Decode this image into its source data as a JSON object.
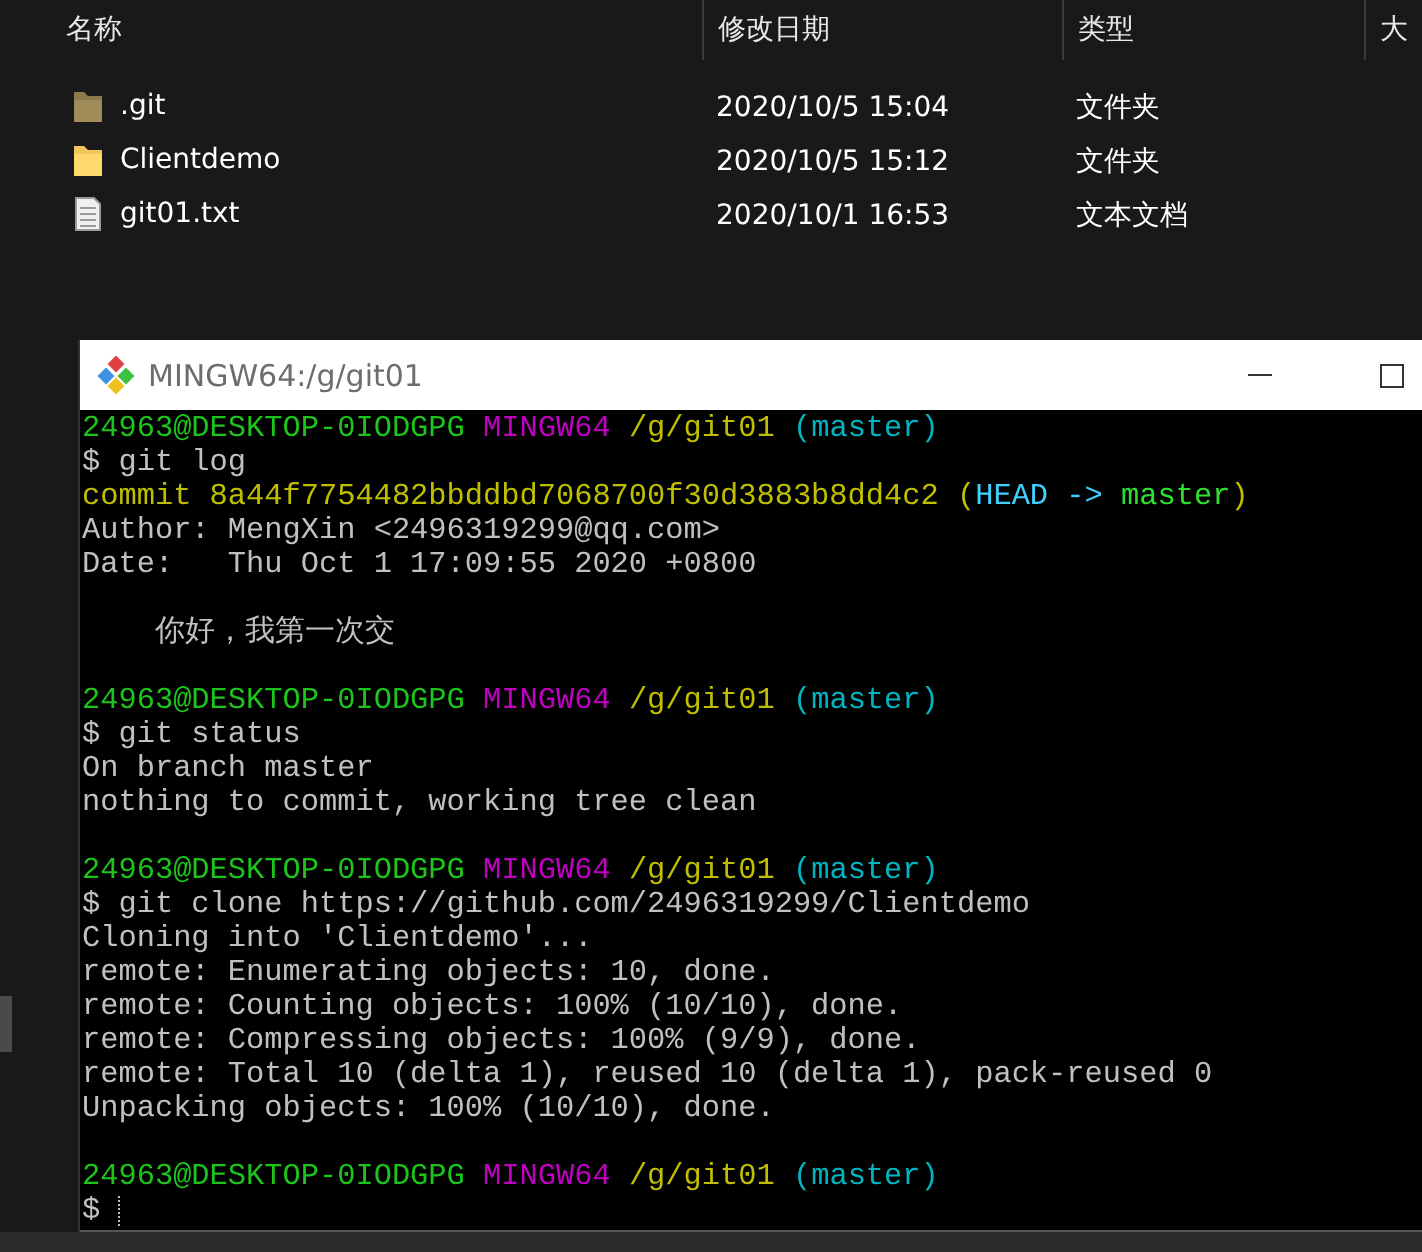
{
  "explorer": {
    "columns": [
      "名称",
      "修改日期",
      "类型",
      "大"
    ],
    "rows": [
      {
        "kind": "folder",
        "hidden": true,
        "name": ".git",
        "modified": "2020/10/5 15:04",
        "type": "文件夹"
      },
      {
        "kind": "folder",
        "hidden": false,
        "name": "Clientdemo",
        "modified": "2020/10/5 15:12",
        "type": "文件夹"
      },
      {
        "kind": "file",
        "hidden": false,
        "name": "git01.txt",
        "modified": "2020/10/1 16:53",
        "type": "文本文档"
      }
    ]
  },
  "terminal": {
    "title": "MINGW64:/g/git01",
    "blocks": [
      [
        {
          "spans": [
            {
              "kind": "user",
              "text": "24963@DESKTOP-0IODGPG"
            },
            {
              "kind": "host",
              "text": " MINGW64"
            },
            {
              "kind": "path",
              "text": " /g/git01"
            },
            {
              "kind": "branch",
              "text": " (master)"
            }
          ]
        },
        {
          "spans": [
            {
              "kind": "text",
              "text": "$ git log"
            }
          ]
        },
        {
          "spans": [
            {
              "kind": "commit",
              "text": "commit 8a44f7754482bbddbd7068700f30d3883b8dd4c2 ("
            },
            {
              "kind": "head",
              "text": "HEAD -> "
            },
            {
              "kind": "ref",
              "text": "master"
            },
            {
              "kind": "commit",
              "text": ")"
            }
          ]
        },
        {
          "spans": [
            {
              "kind": "text",
              "text": "Author: MengXin <2496319299@qq.com>"
            }
          ]
        },
        {
          "spans": [
            {
              "kind": "text",
              "text": "Date:   Thu Oct 1 17:09:55 2020 +0800"
            }
          ]
        }
      ],
      [
        {
          "spans": [
            {
              "kind": "text",
              "text": "    你好，我第一次交"
            }
          ]
        }
      ],
      [
        {
          "spans": [
            {
              "kind": "user",
              "text": "24963@DESKTOP-0IODGPG"
            },
            {
              "kind": "host",
              "text": " MINGW64"
            },
            {
              "kind": "path",
              "text": " /g/git01"
            },
            {
              "kind": "branch",
              "text": " (master)"
            }
          ]
        },
        {
          "spans": [
            {
              "kind": "text",
              "text": "$ git status"
            }
          ]
        },
        {
          "spans": [
            {
              "kind": "text",
              "text": "On branch master"
            }
          ]
        },
        {
          "spans": [
            {
              "kind": "text",
              "text": "nothing to commit, working tree clean"
            }
          ]
        }
      ],
      [
        {
          "spans": [
            {
              "kind": "user",
              "text": "24963@DESKTOP-0IODGPG"
            },
            {
              "kind": "host",
              "text": " MINGW64"
            },
            {
              "kind": "path",
              "text": " /g/git01"
            },
            {
              "kind": "branch",
              "text": " (master)"
            }
          ]
        },
        {
          "spans": [
            {
              "kind": "text",
              "text": "$ git clone https://github.com/2496319299/Clientdemo"
            }
          ]
        },
        {
          "spans": [
            {
              "kind": "text",
              "text": "Cloning into 'Clientdemo'..."
            }
          ]
        },
        {
          "spans": [
            {
              "kind": "text",
              "text": "remote: Enumerating objects: 10, done."
            }
          ]
        },
        {
          "spans": [
            {
              "kind": "text",
              "text": "remote: Counting objects: 100% (10/10), done."
            }
          ]
        },
        {
          "spans": [
            {
              "kind": "text",
              "text": "remote: Compressing objects: 100% (9/9), done."
            }
          ]
        },
        {
          "spans": [
            {
              "kind": "text",
              "text": "remote: Total 10 (delta 1), reused 10 (delta 1), pack-reused 0"
            }
          ]
        },
        {
          "spans": [
            {
              "kind": "text",
              "text": "Unpacking objects: 100% (10/10), done."
            }
          ]
        }
      ],
      [
        {
          "spans": [
            {
              "kind": "user",
              "text": "24963@DESKTOP-0IODGPG"
            },
            {
              "kind": "host",
              "text": " MINGW64"
            },
            {
              "kind": "path",
              "text": " /g/git01"
            },
            {
              "kind": "branch",
              "text": " (master)"
            }
          ]
        },
        {
          "spans": [
            {
              "kind": "text",
              "text": "$"
            }
          ],
          "cursor": true
        }
      ]
    ]
  }
}
